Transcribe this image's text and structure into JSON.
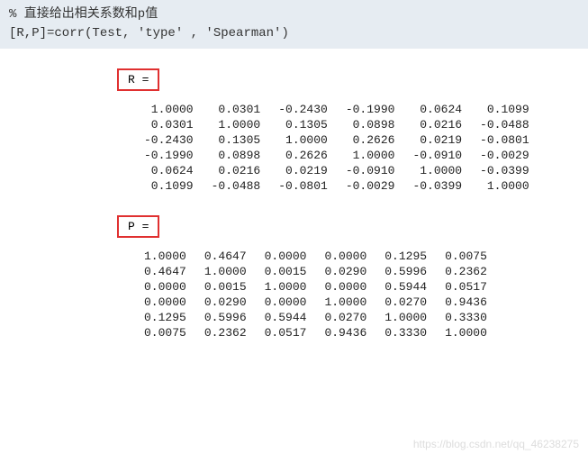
{
  "code": {
    "comment": "% 直接给出相关系数和p值",
    "call": "[R,P]=corr(Test, 'type' , 'Spearman')"
  },
  "labels": {
    "R": "R =",
    "P": "P ="
  },
  "chart_data": [
    {
      "type": "table",
      "title": "R",
      "values": [
        [
          1.0,
          0.0301,
          -0.243,
          -0.199,
          0.0624,
          0.1099
        ],
        [
          0.0301,
          1.0,
          0.1305,
          0.0898,
          0.0216,
          -0.0488
        ],
        [
          -0.243,
          0.1305,
          1.0,
          0.2626,
          0.0219,
          -0.0801
        ],
        [
          -0.199,
          0.0898,
          0.2626,
          1.0,
          -0.091,
          -0.0029
        ],
        [
          0.0624,
          0.0216,
          0.0219,
          -0.091,
          1.0,
          -0.0399
        ],
        [
          0.1099,
          -0.0488,
          -0.0801,
          -0.0029,
          -0.0399,
          1.0
        ]
      ]
    },
    {
      "type": "table",
      "title": "P",
      "values": [
        [
          1.0,
          0.4647,
          0.0,
          0.0,
          0.1295,
          0.0075
        ],
        [
          0.4647,
          1.0,
          0.0015,
          0.029,
          0.5996,
          0.2362
        ],
        [
          0.0,
          0.0015,
          1.0,
          0.0,
          0.5944,
          0.0517
        ],
        [
          0.0,
          0.029,
          0.0,
          1.0,
          0.027,
          0.9436
        ],
        [
          0.1295,
          0.5996,
          0.5944,
          0.027,
          1.0,
          0.333
        ],
        [
          0.0075,
          0.2362,
          0.0517,
          0.9436,
          0.333,
          1.0
        ]
      ]
    }
  ],
  "watermark": "https://blog.csdn.net/qq_46238275"
}
